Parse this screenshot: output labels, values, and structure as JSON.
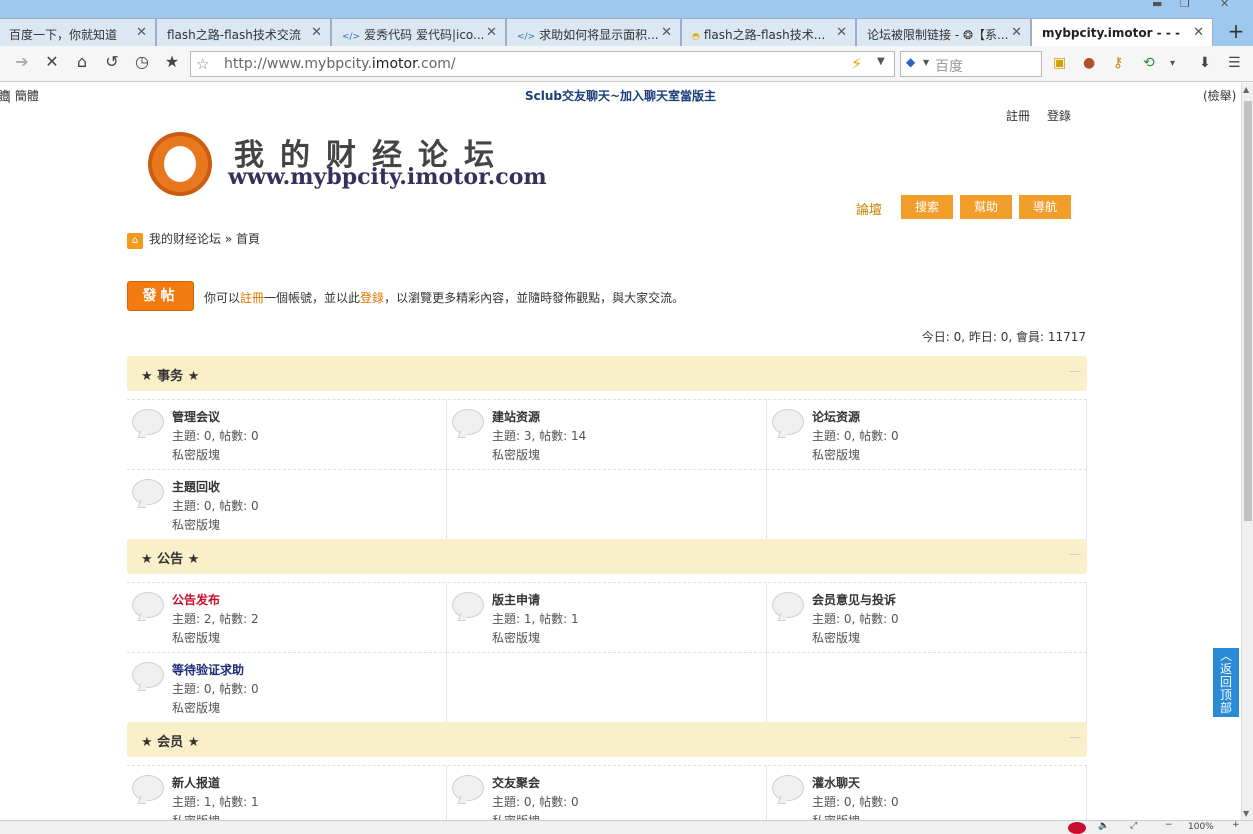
{
  "browser": {
    "tabs": [
      {
        "title": "百度一下，你就知道",
        "icon": "",
        "active": false
      },
      {
        "title": "flash之路-flash技术交流",
        "icon": "",
        "active": false
      },
      {
        "title": "爱秀代码 爱代码|ico...",
        "icon": "</>",
        "active": false
      },
      {
        "title": "求助如何将显示面积...",
        "icon": "</>",
        "active": false
      },
      {
        "title": "flash之路-flash技术...",
        "icon": "",
        "active": false
      },
      {
        "title": "论坛被限制链接 - ❂【系...",
        "icon": "",
        "active": false
      },
      {
        "title": "mybpcity.imotor - - -",
        "icon": "",
        "active": true
      }
    ],
    "url_prefix": "http://www.mybpcity.",
    "url_domain": "imotor",
    "url_suffix": ".com/",
    "search_placeholder": "百度",
    "zoom": "100%"
  },
  "page": {
    "lang_switch": "| 簡體",
    "lang_left_glyph": "體",
    "promo": "Sclub交友聊天~加入聊天室當版主",
    "top_right_link": "(檢舉)",
    "register": "註冊",
    "login": "登錄",
    "logo_cn": "我的财经论坛",
    "logo_en": "www.mybpcity.imotor.com",
    "nav_forum": "論壇",
    "nav_buttons": [
      "搜索",
      "幫助",
      "導航"
    ],
    "breadcrumb_home": "我的财经论坛",
    "breadcrumb_sep": "»",
    "breadcrumb_current": "首頁",
    "post_button": "發帖",
    "post_note_1": "你可以",
    "post_note_register": "註冊",
    "post_note_2": "一個帳號，並以此",
    "post_note_login": "登錄",
    "post_note_3": "，以瀏覽更多精彩內容，並隨時發佈觀點，與大家交流。",
    "stats": "今日: 0, 昨日: 0, 會員: 11717",
    "back_to_top": "返回顶部"
  },
  "sections": [
    {
      "title": "★ 事务 ★",
      "forums": [
        {
          "name": "管理会议",
          "stat": "主題: 0, 帖數: 0",
          "desc": "私密版塊",
          "color": "normal"
        },
        {
          "name": "建站资源",
          "stat": "主題: 3, 帖數: 14",
          "desc": "私密版塊",
          "color": "normal"
        },
        {
          "name": "论坛资源",
          "stat": "主題: 0, 帖數: 0",
          "desc": "私密版塊",
          "color": "normal"
        },
        {
          "name": "主題回收",
          "stat": "主題: 0, 帖數: 0",
          "desc": "私密版塊",
          "color": "normal"
        }
      ]
    },
    {
      "title": "★ 公告 ★",
      "forums": [
        {
          "name": "公告发布",
          "stat": "主題: 2, 帖數: 2",
          "desc": "私密版塊",
          "color": "red"
        },
        {
          "name": "版主申请",
          "stat": "主題: 1, 帖數: 1",
          "desc": "私密版塊",
          "color": "normal"
        },
        {
          "name": "会员意见与投诉",
          "stat": "主題: 0, 帖數: 0",
          "desc": "私密版塊",
          "color": "normal"
        },
        {
          "name": "等待验证求助",
          "stat": "主題: 0, 帖數: 0",
          "desc": "私密版塊",
          "color": "blue"
        }
      ]
    },
    {
      "title": "★ 会员 ★",
      "forums": [
        {
          "name": "新人报道",
          "stat": "主題: 1, 帖數: 1",
          "desc": "私密版塊",
          "color": "normal"
        },
        {
          "name": "交友聚会",
          "stat": "主題: 0, 帖數: 0",
          "desc": "私密版塊",
          "color": "normal"
        },
        {
          "name": "灌水聊天",
          "stat": "主題: 0, 帖數: 0",
          "desc": "私密版塊",
          "color": "normal"
        }
      ]
    }
  ],
  "colors": {
    "accent_orange": "#f19e2b",
    "section_bg": "#f9f0c9",
    "link_orange": "#e07400",
    "forum_red": "#c8102e",
    "forum_blue": "#1c2b7a"
  },
  "icons": {
    "back": "arrow-right-icon",
    "stop": "close-icon",
    "home": "home-icon",
    "undo": "undo-icon",
    "history": "clock-icon",
    "favorites": "star-icon"
  }
}
